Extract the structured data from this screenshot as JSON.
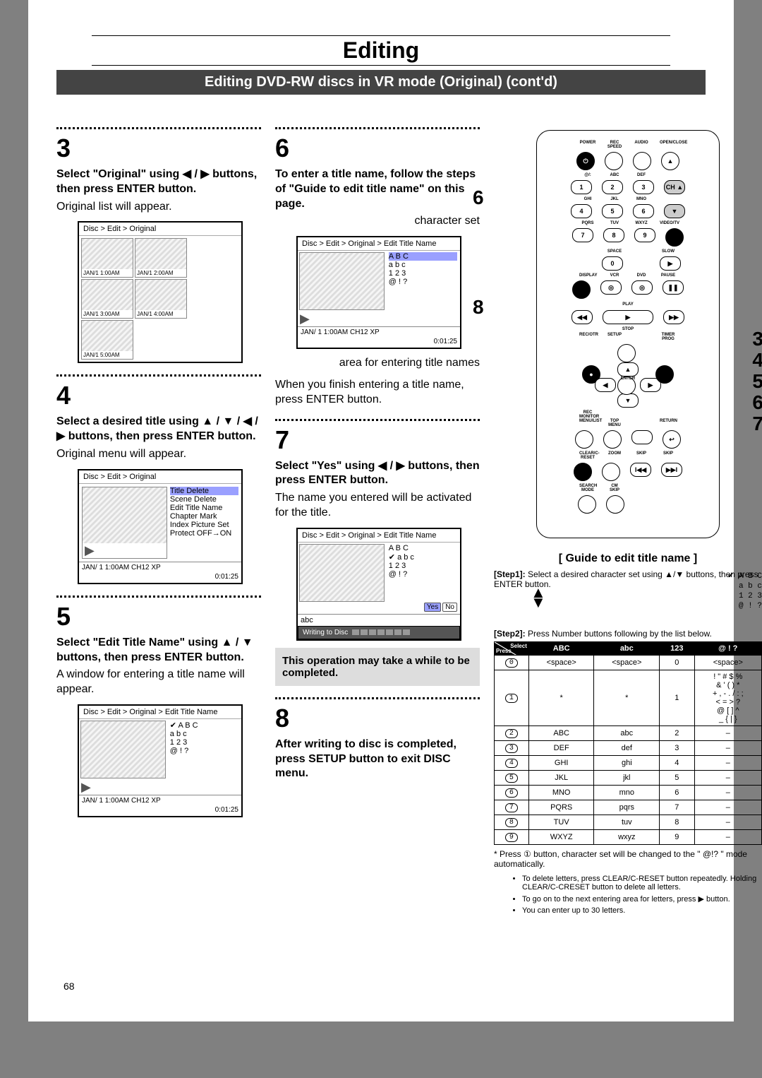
{
  "page_number": "68",
  "header": {
    "main_title": "Editing",
    "sub_title": "Editing DVD-RW discs in VR mode (Original) (cont'd)"
  },
  "col1": {
    "step3": {
      "num": "3",
      "instr": "Select \"Original\" using ◀ / ▶ buttons, then press ENTER button.",
      "result": "Original list will appear.",
      "screen_title": "Disc > Edit > Original",
      "cells": [
        "JAN/1 1:00AM",
        "JAN/1 2:00AM",
        "JAN/1 3:00AM",
        "JAN/1 4:00AM",
        "JAN/1 5:00AM"
      ]
    },
    "step4": {
      "num": "4",
      "instr": "Select a desired title using ▲ / ▼ / ◀ / ▶ buttons, then press ENTER button.",
      "result": "Original menu will appear.",
      "screen_title": "Disc > Edit > Original",
      "menu_items": [
        "Title Delete",
        "Scene Delete",
        "Edit Title Name",
        "Chapter Mark",
        "Index Picture Set",
        "Protect OFF→ON"
      ],
      "foot_left": "JAN/ 1  1:00AM  CH12   XP",
      "foot_right": "0:01:25"
    },
    "step5": {
      "num": "5",
      "instr": "Select \"Edit Title Name\" using ▲ / ▼ buttons, then press ENTER button.",
      "result": "A window for entering a title name will appear.",
      "screen_title": "Disc > Edit > Original > Edit Title Name",
      "opts": [
        "A B C",
        "a b c",
        "1 2 3",
        "@ ! ?"
      ],
      "selected": 0,
      "foot_left": "JAN/ 1  1:00AM  CH12  XP",
      "foot_right": "0:01:25"
    }
  },
  "col2": {
    "step6": {
      "num": "6",
      "instr": "To enter a title name, follow the steps of \"Guide to edit title name\" on this page.",
      "callout_top": "character set",
      "screen_title": "Disc > Edit > Original > Edit Title Name",
      "opts": [
        "A B C",
        "a b c",
        "1 2 3",
        "@ ! ?"
      ],
      "sel_opt": 0,
      "foot_left": "JAN/ 1   1:00AM   CH12   XP",
      "foot_right": "0:01:25",
      "callout_bottom": "area for entering title names",
      "after": "When you finish entering a title name, press ENTER button."
    },
    "step7": {
      "num": "7",
      "instr": "Select \"Yes\" using ◀ / ▶ buttons, then press ENTER button.",
      "result": "The name you entered will be activated for the title.",
      "screen_title": "Disc > Edit > Original > Edit Title Name",
      "opts": [
        "A B C",
        "a b c",
        "1 2 3",
        "@ ! ?"
      ],
      "sel_opt": 1,
      "entry_text": "abc",
      "yes": "Yes",
      "no": "No",
      "write_label": "Writing to Disc",
      "notebox": "This operation may take a while to be completed."
    },
    "step8": {
      "num": "8",
      "instr": "After writing to disc is completed, press SETUP button to exit DISC menu."
    }
  },
  "col3": {
    "side_nums_left": {
      "6": "6",
      "8": "8"
    },
    "side_nums_right": {
      "3": "3",
      "4": "4",
      "5": "5",
      "6": "6",
      "7": "7"
    },
    "remote": {
      "row1_lbl": [
        "POWER",
        "REC SPEED",
        "AUDIO",
        "OPEN/CLOSE"
      ],
      "row2_lbl": [
        "@/:",
        "ABC",
        "DEF",
        ""
      ],
      "row3_lbl": [
        "GHI",
        "JKL",
        "MNO",
        ""
      ],
      "row4_lbl": [
        "PQRS",
        "TUV",
        "WXYZ",
        "VIDEO/TV"
      ],
      "row5_lbl": [
        "",
        "SPACE",
        "",
        "SLOW"
      ],
      "row6_lbl": [
        "DISPLAY",
        "VCR",
        "DVD",
        "PAUSE"
      ],
      "play_lbl": "PLAY",
      "stop_lbl": "STOP",
      "rowR_lbl": [
        "REC/OTR",
        "SETUP",
        "",
        "TIMER PROG"
      ],
      "rowE_lbl": [
        "",
        "",
        "ENTER",
        ""
      ],
      "rowM_lbl": [
        "REC MONITOR",
        "",
        "",
        ""
      ],
      "rowN_lbl": [
        "MENU/LIST",
        "TOP MENU",
        "",
        "RETURN"
      ],
      "rowZ_lbl": [
        "CLEAR/C-RESET",
        "ZOOM",
        "SKIP",
        "SKIP"
      ],
      "rowS_lbl": [
        "SEARCH MODE",
        "CM SKIP",
        "",
        ""
      ]
    },
    "guide": {
      "title": "[ Guide to edit title name ]",
      "step1_label": "[Step1]:",
      "step1_text": "Select a desired character set using ▲/▼ buttons, then press ENTER button.",
      "mini_sets": [
        "✔  A B C",
        "a b c",
        "1 2 3",
        "@ ! ?"
      ],
      "step2_label": "[Step2]:",
      "step2_text": "Press Number buttons following by the list below.",
      "table": {
        "diag_top": "Select",
        "diag_bottom": "Press",
        "headers": [
          "ABC",
          "abc",
          "123",
          "@ ! ?"
        ],
        "rows": [
          {
            "k": "0",
            "c": [
              "<space>",
              "<space>",
              "0",
              "<space>"
            ]
          },
          {
            "k": "1",
            "c": [
              "*",
              "*",
              "1",
              "! \" # $ %\n& ' ( ) *\n+ , - . / : ;\n< = > ?\n@ [ ] ^\n_ { | }"
            ]
          },
          {
            "k": "2",
            "c": [
              "ABC",
              "abc",
              "2",
              "–"
            ]
          },
          {
            "k": "3",
            "c": [
              "DEF",
              "def",
              "3",
              "–"
            ]
          },
          {
            "k": "4",
            "c": [
              "GHI",
              "ghi",
              "4",
              "–"
            ]
          },
          {
            "k": "5",
            "c": [
              "JKL",
              "jkl",
              "5",
              "–"
            ]
          },
          {
            "k": "6",
            "c": [
              "MNO",
              "mno",
              "6",
              "–"
            ]
          },
          {
            "k": "7",
            "c": [
              "PQRS",
              "pqrs",
              "7",
              "–"
            ]
          },
          {
            "k": "8",
            "c": [
              "TUV",
              "tuv",
              "8",
              "–"
            ]
          },
          {
            "k": "9",
            "c": [
              "WXYZ",
              "wxyz",
              "9",
              "–"
            ]
          }
        ]
      },
      "footnote": "* Press ① button, character set will be changed to the \" @!? \" mode automatically.",
      "notes": [
        "To delete letters, press CLEAR/C-RESET button repeatedly. Holding CLEAR/C-CRESET button to delete all letters.",
        "To go on to the next entering area for letters, press ▶ button.",
        "You can enter up to 30 letters."
      ]
    }
  }
}
